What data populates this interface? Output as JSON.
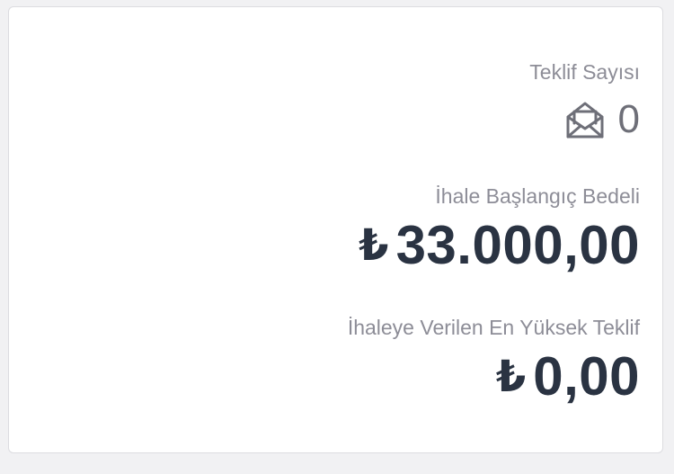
{
  "bid_count": {
    "label": "Teklif Sayısı",
    "icon": "envelope-open-icon",
    "value": "0"
  },
  "starting_price": {
    "label": "İhale Başlangıç Bedeli",
    "currency_symbol": "₺",
    "value": "33.000,00"
  },
  "highest_bid": {
    "label": "İhaleye Verilen En Yüksek Teklif",
    "currency_symbol": "₺",
    "value": "0,00"
  },
  "colors": {
    "label": "#8d8d97",
    "count": "#6e6f78",
    "amount": "#2a3342",
    "card_background": "#ffffff",
    "page_background": "#f1f1f3"
  }
}
